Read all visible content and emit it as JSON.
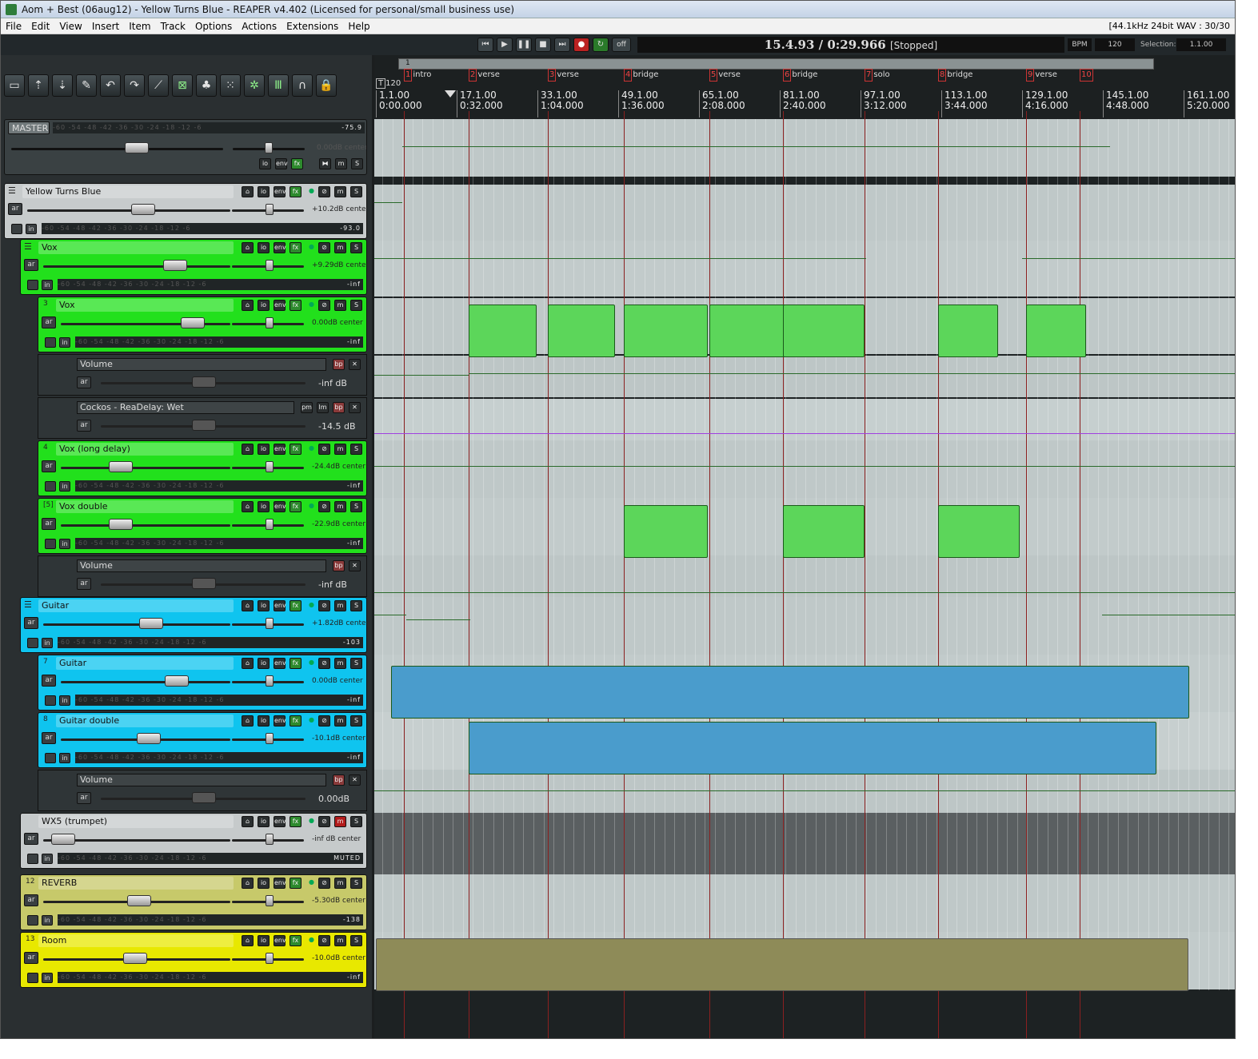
{
  "window_title": "Aom + Best (06aug12) - Yellow Turns Blue - REAPER v4.402 (Licensed for personal/small business use)",
  "menu": [
    "File",
    "Edit",
    "View",
    "Insert",
    "Item",
    "Track",
    "Options",
    "Actions",
    "Extensions",
    "Help"
  ],
  "format_info": "[44.1kHz 24bit WAV : 30/30",
  "transport": {
    "time": "15.4.93 / 0:29.966",
    "state": "[Stopped]",
    "bpm_label": "BPM",
    "bpm": "120",
    "selection_label": "Selection:",
    "selection": "1.1.00",
    "off_label": "off"
  },
  "toolbar_icons": [
    "new-project-icon",
    "open-icon",
    "save-icon",
    "preferences-icon",
    "undo-icon",
    "redo-icon",
    "metronome-icon",
    "snap-icon",
    "ripple-icon",
    "grid-icon",
    "crossfade-icon",
    "envelope-lock-icon",
    "tracks-lock-icon",
    "lock-icon"
  ],
  "ruler": {
    "tempo": "120",
    "first_marker": "1",
    "markers": [
      {
        "n": "1",
        "name": "intro"
      },
      {
        "n": "2",
        "name": "verse"
      },
      {
        "n": "3",
        "name": "verse"
      },
      {
        "n": "4",
        "name": "bridge"
      },
      {
        "n": "5",
        "name": "verse"
      },
      {
        "n": "6",
        "name": "bridge"
      },
      {
        "n": "7",
        "name": "solo"
      },
      {
        "n": "8",
        "name": "bridge"
      },
      {
        "n": "9",
        "name": "verse"
      },
      {
        "n": "10",
        "name": ""
      }
    ],
    "ticks": [
      {
        "bar": "1.1.00",
        "time": "0:00.000"
      },
      {
        "bar": "17.1.00",
        "time": "0:32.000"
      },
      {
        "bar": "33.1.00",
        "time": "1:04.000"
      },
      {
        "bar": "49.1.00",
        "time": "1:36.000"
      },
      {
        "bar": "65.1.00",
        "time": "2:08.000"
      },
      {
        "bar": "81.1.00",
        "time": "2:40.000"
      },
      {
        "bar": "97.1.00",
        "time": "3:12.000"
      },
      {
        "bar": "113.1.00",
        "time": "3:44.000"
      },
      {
        "bar": "129.1.00",
        "time": "4:16.000"
      },
      {
        "bar": "145.1.00",
        "time": "4:48.000"
      },
      {
        "bar": "161.1.00",
        "time": "5:20.000"
      }
    ]
  },
  "meter_scale": "-60  -54  -48  -42  -36  -30  -24  -18  -12  -6",
  "master": {
    "label": "MASTER",
    "peak": "-75.9",
    "vol": "0.00dB center"
  },
  "tracks": [
    {
      "num": "",
      "name": "Yellow Turns Blue",
      "vol": "+10.2dB center",
      "peak": "-93.0"
    },
    {
      "num": "",
      "name": "Vox",
      "vol": "+9.29dB center",
      "peak": "-inf"
    },
    {
      "num": "3",
      "name": "Vox",
      "vol": "0.00dB center",
      "peak": "-inf"
    },
    {
      "num": "4",
      "name": "Vox (long delay)",
      "vol": "-24.4dB center",
      "peak": "-inf"
    },
    {
      "num": "[5]",
      "name": "Vox double",
      "vol": "-22.9dB center",
      "peak": "-inf"
    },
    {
      "num": "",
      "name": "Guitar",
      "vol": "+1.82dB center",
      "peak": "-103"
    },
    {
      "num": "7",
      "name": "Guitar",
      "vol": "0.00dB center",
      "peak": "-inf"
    },
    {
      "num": "8",
      "name": "Guitar double",
      "vol": "-10.1dB center",
      "peak": "-inf"
    },
    {
      "num": "",
      "name": "WX5 (trumpet)",
      "vol": "-inf dB center",
      "peak": "MUTED"
    },
    {
      "num": "12",
      "name": "REVERB",
      "vol": "-5.30dB center",
      "peak": "-138"
    },
    {
      "num": "13",
      "name": "Room",
      "vol": "-10.0dB center",
      "peak": "-inf"
    }
  ],
  "envelopes": [
    {
      "name": "Volume",
      "value": "-inf dB"
    },
    {
      "name": "Cockos - ReaDelay: Wet",
      "value": "-14.5 dB"
    },
    {
      "name": "Volume",
      "value": "-inf dB"
    },
    {
      "name": "Volume",
      "value": "0.00dB"
    }
  ],
  "btn": {
    "io": "io",
    "env": "env",
    "fx": "fx",
    "m": "m",
    "s": "S",
    "ar": "ar",
    "in": "in",
    "bp": "bp",
    "pm": "pm",
    "lm": "lm",
    "x": "✕"
  },
  "colors": {
    "green": "#22e01c",
    "cyan": "#0fc4ef",
    "grey": "#c7cbcc",
    "olive": "#c7c96a",
    "yellow": "#e8e800"
  }
}
